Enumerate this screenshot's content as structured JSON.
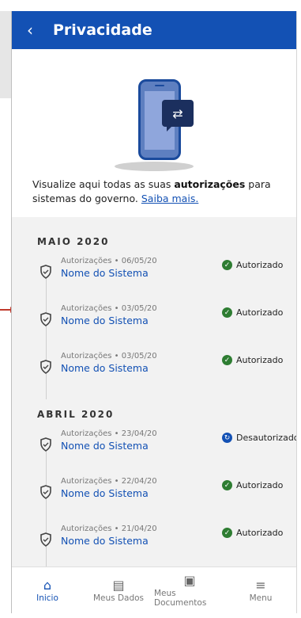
{
  "header": {
    "back_icon": "chevron-left-icon",
    "title": "Privacidade"
  },
  "hero": {
    "text_prefix": "Visualize aqui todas as suas ",
    "text_bold": "autorizações",
    "text_suffix": " para sistemas do governo.",
    "link": "Saiba mais."
  },
  "months": [
    {
      "label": "MAIO 2020",
      "items": [
        {
          "meta": "Autorizações • 06/05/20",
          "name": "Nome do Sistema",
          "status": "Autorizado"
        },
        {
          "meta": "Autorizações • 03/05/20",
          "name": "Nome do Sistema",
          "status": "Autorizado"
        },
        {
          "meta": "Autorizações • 03/05/20",
          "name": "Nome do Sistema",
          "status": "Autorizado"
        }
      ]
    },
    {
      "label": "ABRIL 2020",
      "items": [
        {
          "meta": "Autorizações • 23/04/20",
          "name": "Nome do Sistema",
          "status": "Desautorizado"
        },
        {
          "meta": "Autorizações • 22/04/20",
          "name": "Nome do Sistema",
          "status": "Autorizado"
        },
        {
          "meta": "Autorizações • 21/04/20",
          "name": "Nome do Sistema",
          "status": "Autorizado"
        }
      ]
    }
  ],
  "nav": [
    {
      "label": "Inicio",
      "icon": "home-icon",
      "active": true
    },
    {
      "label": "Meus Dados",
      "icon": "clipboard-icon",
      "active": false
    },
    {
      "label": "Meus Documentos",
      "icon": "id-card-icon",
      "active": false
    },
    {
      "label": "Menu",
      "icon": "hamburger-icon",
      "active": false
    }
  ],
  "colors": {
    "primary": "#1351b4",
    "success": "#2e7d32"
  }
}
